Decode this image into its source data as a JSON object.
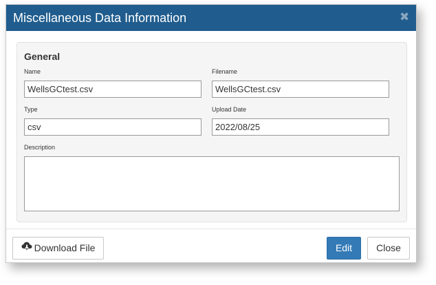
{
  "modal": {
    "title": "Miscellaneous Data Information",
    "close_icon": "close-icon"
  },
  "panel": {
    "heading": "General",
    "fields": {
      "name": {
        "label": "Name",
        "value": "WellsGCtest.csv"
      },
      "filename": {
        "label": "Filename",
        "value": "WellsGCtest.csv"
      },
      "type": {
        "label": "Type",
        "value": "csv"
      },
      "upload_date": {
        "label": "Upload Date",
        "value": "2022/08/25"
      },
      "description": {
        "label": "Description",
        "value": ""
      }
    }
  },
  "footer": {
    "download_label": "Download File",
    "download_icon": "cloud-download-icon",
    "edit_label": "Edit",
    "close_label": "Close"
  },
  "colors": {
    "header_bg": "#205d8e",
    "primary_button": "#337ab7"
  }
}
